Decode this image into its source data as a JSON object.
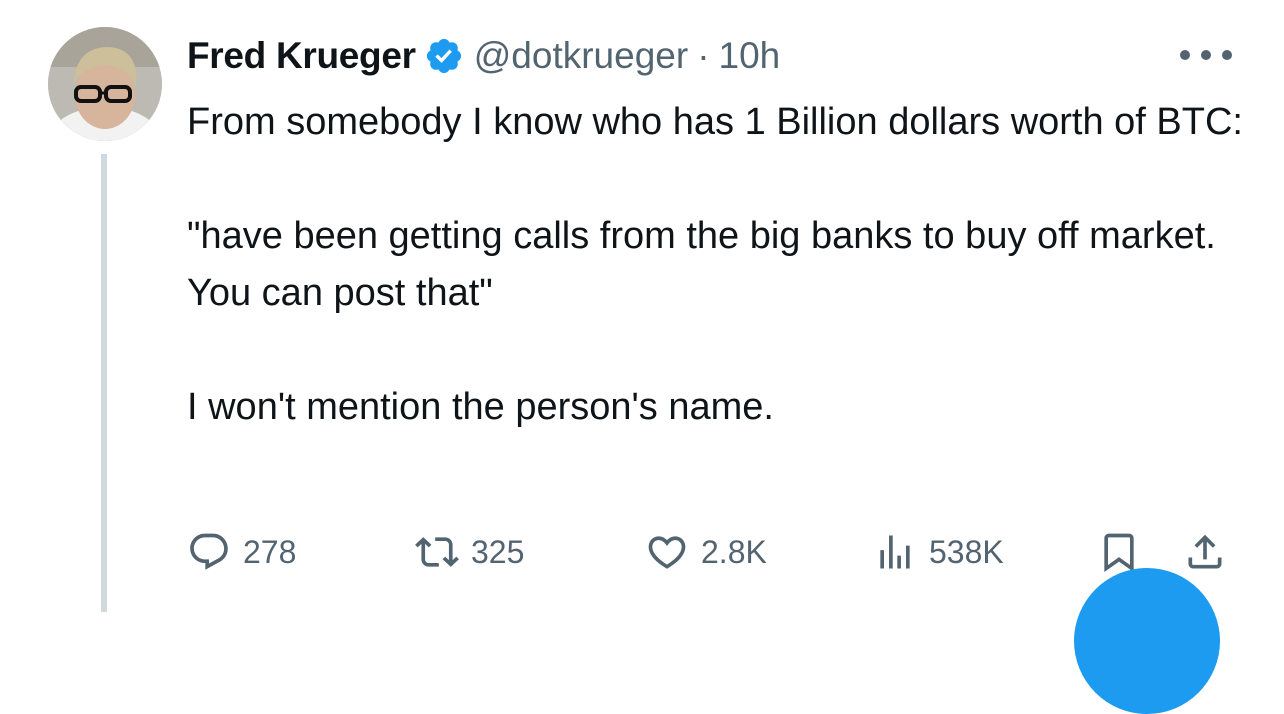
{
  "tweet": {
    "author_name": "Fred Krueger",
    "handle": "@dotkrueger",
    "separator": "·",
    "time": "10h",
    "verified": true,
    "lines": [
      "From somebody I know who has 1 Billion dollars worth of BTC:",
      "\"have been getting calls from the big banks to buy off market. You can post that\"",
      "I won't mention the person's name."
    ]
  },
  "actions": {
    "replies": "278",
    "reposts": "325",
    "likes": "2.8K",
    "views": "538K"
  },
  "colors": {
    "text": "#0f1419",
    "secondary": "#536471",
    "accent": "#1d9bf0",
    "thread_line": "#cfd9de"
  },
  "icons": [
    "more-icon",
    "verified-icon",
    "reply-icon",
    "repost-icon",
    "like-icon",
    "views-icon",
    "bookmark-icon",
    "share-icon"
  ]
}
